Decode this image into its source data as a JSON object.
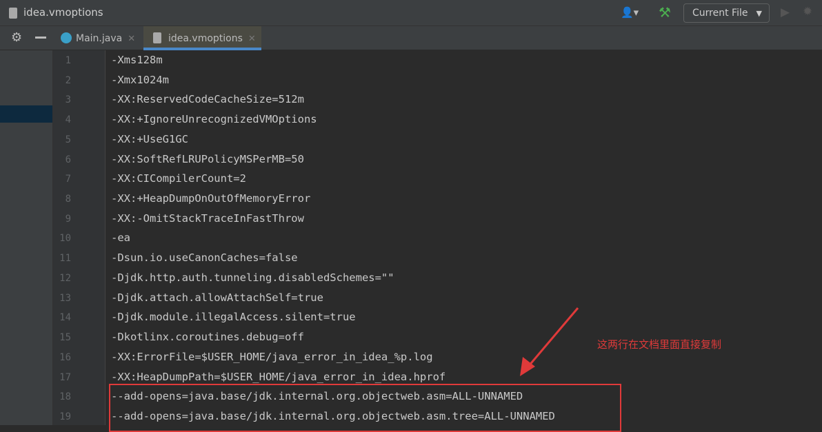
{
  "window": {
    "title": "idea.vmoptions"
  },
  "toolbar": {
    "run_config": "Current File"
  },
  "tabs": [
    {
      "label": "Main.java"
    },
    {
      "label": "idea.vmoptions",
      "active": true
    }
  ],
  "editor": {
    "lines": [
      "-Xms128m",
      "-Xmx1024m",
      "-XX:ReservedCodeCacheSize=512m",
      "-XX:+IgnoreUnrecognizedVMOptions",
      "-XX:+UseG1GC",
      "-XX:SoftRefLRUPolicyMSPerMB=50",
      "-XX:CICompilerCount=2",
      "-XX:+HeapDumpOnOutOfMemoryError",
      "-XX:-OmitStackTraceInFastThrow",
      "-ea",
      "-Dsun.io.useCanonCaches=false",
      "-Djdk.http.auth.tunneling.disabledSchemes=\"\"",
      "-Djdk.attach.allowAttachSelf=true",
      "-Djdk.module.illegalAccess.silent=true",
      "-Dkotlinx.coroutines.debug=off",
      "-XX:ErrorFile=$USER_HOME/java_error_in_idea_%p.log",
      "-XX:HeapDumpPath=$USER_HOME/java_error_in_idea.hprof",
      "--add-opens=java.base/jdk.internal.org.objectweb.asm=ALL-UNNAMED",
      "--add-opens=java.base/jdk.internal.org.objectweb.asm.tree=ALL-UNNAMED"
    ]
  },
  "annotation": {
    "text": "这两行在文档里面直接复制",
    "color": "#e03a3a"
  },
  "colors": {
    "accent": "#4a88c7",
    "build": "#4caf50"
  }
}
